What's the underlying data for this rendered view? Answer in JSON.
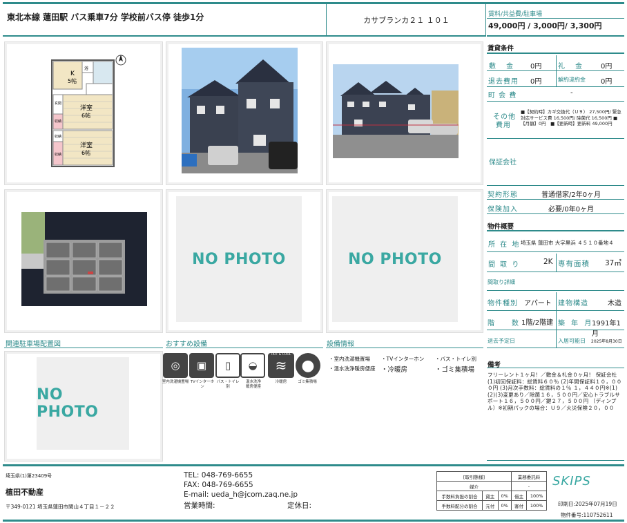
{
  "header": {
    "access": "東北本線 蓮田駅 バス乗車7分 学校前バス停 徒歩1分",
    "building": "カサブランカ２１ １０１",
    "fee_label": "賃料/共益費/駐車場",
    "fee_value": "49,000円 / 3,000円/ 3,300円"
  },
  "photos": {
    "no_photo": "NO PHOTO",
    "floorplan": {
      "kitchen": "K",
      "kitchen_size": "5帖",
      "room1": "洋室",
      "room1_size": "6帖",
      "room2": "洋室",
      "room2_size": "6帖",
      "entrance": "玄関",
      "storage": "収納",
      "bath": "浴"
    }
  },
  "sections": {
    "parking": "関連駐車場配置図",
    "equipment": "おすすめ設備",
    "facilities": "設備情報"
  },
  "equipment_icons": [
    {
      "icon": "washer-icon",
      "glyph": "◎",
      "label": "室内洗濯機置場"
    },
    {
      "icon": "intercom-icon",
      "glyph": "▣",
      "label": "TVインターホン"
    },
    {
      "icon": "bath-toilet-icon",
      "glyph": "▯",
      "label": "バス・トイレ別"
    },
    {
      "icon": "washlet-icon",
      "glyph": "◒",
      "label": "温水洗浄便座"
    },
    {
      "icon": "aircon-icon",
      "glyph": "≋",
      "label": "冷暖房"
    },
    {
      "icon": "garbage-icon",
      "glyph": "●",
      "label": "ゴミ集積場"
    }
  ],
  "equipment_extra": [
    "温水洗浄",
    "暖房便座"
  ],
  "aircon_badge": "HOT & COOL",
  "facilities_list": [
    "・室内洗濯機置場",
    "・TVインターホン",
    "・バス・トイレ別",
    "・温水洗浄暖房便座",
    "・冷暖房",
    "・ゴミ集積場"
  ],
  "conditions": {
    "title": "賃貸条件",
    "shikikin_label": "敷 金",
    "shikikin": "0円",
    "reikin_label": "礼 金",
    "reikin": "0円",
    "taikyo_label": "退去費用",
    "taikyo": "0円",
    "kaiyaku_label": "解約違約金",
    "kaiyaku": "0円",
    "chokai_label": "町 会 費",
    "chokai": "-",
    "other_label1": "その他",
    "other_label2": "費用",
    "other_text": "■【契約時】カギ交換代（Ｕ９） 27,500円/ 緊急対応サービス費 16,500円/ 除菌代 16,500円 ■【月額】0円　■【更新時】更新料 49,000円",
    "guarantee_label": "保証会社",
    "contract_label": "契約形態",
    "contract": "普通借家/2年0ヶ月",
    "insurance_label": "保険加入",
    "insurance": "必要/0年0ヶ月"
  },
  "overview": {
    "title": "物件概要",
    "address_label": "所 在 地",
    "address": "埼玉県 蓮田市 大字黒浜 ４５１０番地４",
    "layout_label": "間 取 り",
    "layout": "2K",
    "area_label": "専有面積",
    "area": "37㎡",
    "layout_detail_label": "間取り詳細",
    "type_label": "物件種別",
    "type": "アパート",
    "structure_label": "建物構造",
    "structure": "木造",
    "floor_label": "階 数",
    "floor": "1階/2階建",
    "built_label": "築 年 月",
    "built": "1991年1月",
    "vacate_label": "退去予定日",
    "vacate": "",
    "movein_label": "入居可能日",
    "movein": "2025年8月30日"
  },
  "remarks": {
    "title": "備考",
    "text": "フリーレント１ヶ月！／敷金＆礼金０ヶ月！ 保証会社 (1)初回保証料：総賃料６０％ (2)年間保証料１０，０００円 (3)月次手数料：総賃料の１％ １，４４０円※(1)(2)(3)変更あり／除菌１６，５００円／安心トラブルサポート１６，５００円／鍵２７，５００円 （ディンプル）※初期パックの場合：Ｕ９／火災保険２０，００"
  },
  "footer": {
    "license": "埼玉県(1)第23409号",
    "company": "植田不動産",
    "address": "〒349-0121 埼玉県蓮田市閏山４丁目１－２２",
    "tel": "TEL: 048-769-6655",
    "fax": "FAX: 048-769-6655",
    "email": "E-mail: ueda_h@jcom.zaq.ne.jp",
    "hours": "営業時間:",
    "holiday": "定休日:",
    "logo": "SKIPS",
    "printed": "印刷日:2025年07月19日",
    "property_no": "物件番号:110752611"
  },
  "fee_table": {
    "h1": "[取引態様]",
    "h2": "業務委託料",
    "r1": "媒介",
    "r1v": "-",
    "r2": "手数料負担の割合",
    "r2a": "貸主",
    "r2b": "0%",
    "r2c": "借主",
    "r2d": "100%",
    "r3": "手数料配分の割合",
    "r3a": "元付",
    "r3b": "0%",
    "r3c": "客付",
    "r3d": "100%"
  }
}
